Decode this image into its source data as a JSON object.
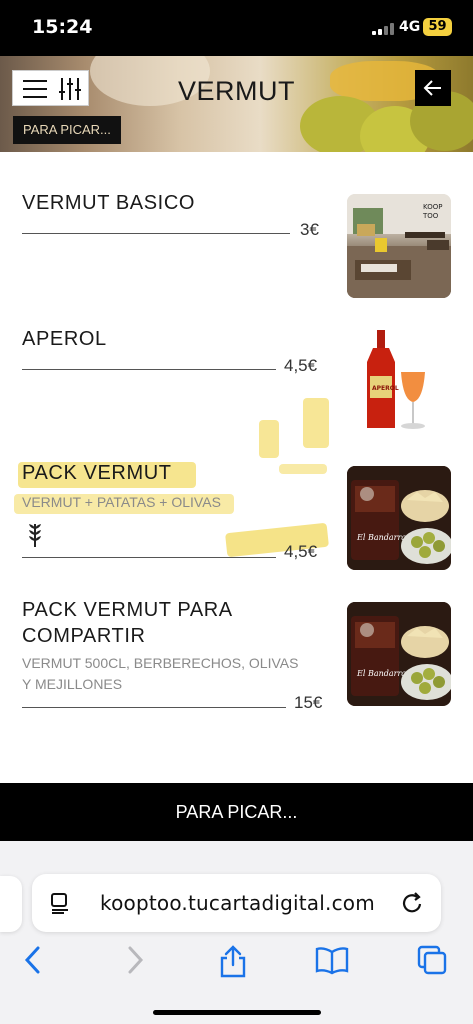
{
  "status_bar": {
    "time": "15:24",
    "network": "4G",
    "battery": "59"
  },
  "header": {
    "title": "VERMUT",
    "category_tag": "PARA PICAR..."
  },
  "menu_items": [
    {
      "name": "VERMUT BASICO",
      "description": "",
      "price": "3€"
    },
    {
      "name": "APEROL",
      "description": "",
      "price": "4,5€"
    },
    {
      "name": "PACK VERMUT",
      "description": "VERMUT + PATATAS + OLIVAS",
      "price": "4,5€"
    },
    {
      "name_line1": "PACK VERMUT PARA",
      "name_line2": "COMPARTIR",
      "desc_line1": "VERMUT 500CL, BERBERECHOS, OLIVAS",
      "desc_line2": "Y MEJILLONES",
      "price": "15€"
    }
  ],
  "image_text": {
    "terrace_logo_1": "KOOP",
    "terrace_logo_2": "TOO",
    "aperol_label": "APEROL",
    "pack_glass_1": "El Bandarra",
    "pack_glass_2": "El Bandarra"
  },
  "category_bar": {
    "label": "PARA PICAR..."
  },
  "browser": {
    "url": "kooptoo.tucartadigital.com"
  },
  "icons": [
    "hamburger-icon",
    "filter-sliders-icon",
    "back-arrow-icon",
    "wheat-icon",
    "page-icon",
    "reload-icon",
    "back-icon",
    "forward-icon",
    "share-icon",
    "bookmarks-icon",
    "tabs-icon"
  ],
  "colors": {
    "highlight": "#f3dc6a",
    "bar": "#000000",
    "battery": "#f4d03f",
    "safari_blue": "#1a73e8"
  }
}
